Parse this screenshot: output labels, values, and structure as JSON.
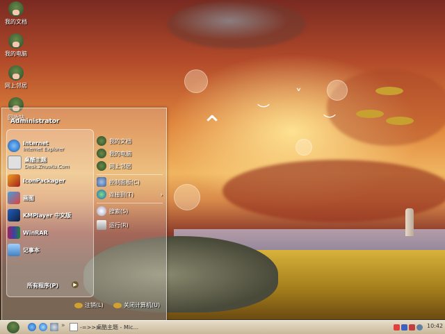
{
  "desktop": {
    "icons": [
      {
        "label": "我的文档",
        "icon": "my-documents-icon"
      },
      {
        "label": "我的电脑",
        "icon": "my-computer-icon"
      },
      {
        "label": "网上邻居",
        "icon": "network-places-icon"
      },
      {
        "label": "回收站",
        "icon": "recycle-bin-icon"
      }
    ]
  },
  "start_menu": {
    "user": "Administrator",
    "pinned": [
      {
        "title": "Internet",
        "subtitle": "Internet Explorer",
        "icon": "internet-explorer-icon"
      },
      {
        "title": "桌酷主题",
        "subtitle": "Desk.ZhuoKu.Com",
        "icon": "zhuoku-theme-icon"
      }
    ],
    "recent": [
      {
        "title": "IconPackager",
        "icon": "iconpackager-icon"
      },
      {
        "title": "画图",
        "icon": "paint-icon"
      },
      {
        "title": "KMPlayer 中文版",
        "icon": "kmplayer-icon"
      },
      {
        "title": "WinRAR",
        "icon": "winrar-icon"
      },
      {
        "title": "记事本",
        "icon": "notepad-icon"
      }
    ],
    "all_programs": "所有程序(P)",
    "right_items": [
      {
        "label": "我的文档",
        "icon": "my-documents-icon"
      },
      {
        "label": "我的电脑",
        "icon": "my-computer-icon"
      },
      {
        "label": "网上邻居",
        "icon": "network-places-icon"
      },
      {
        "label": "控制面板(C)",
        "icon": "control-panel-icon"
      },
      {
        "label": "连接到(T)",
        "icon": "connect-to-icon"
      },
      {
        "label": "搜索(S)",
        "icon": "search-icon"
      },
      {
        "label": "运行(R)",
        "icon": "run-icon"
      }
    ],
    "logoff": "注销(L)",
    "shutdown": "关闭计算机(U)"
  },
  "taskbar": {
    "task_label": "-=>>桌酷主题 - Mic...",
    "clock": "10:42"
  },
  "colors": {
    "accent": "#c8a030",
    "taskbar": "#d8ccb4"
  }
}
